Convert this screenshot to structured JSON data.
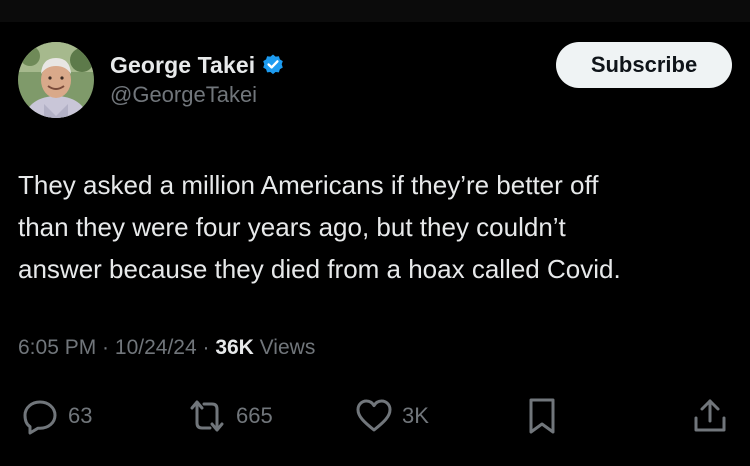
{
  "author": {
    "display_name": "George Takei",
    "handle": "@GeorgeTakei",
    "verified_icon": "verified-badge-icon",
    "verified_color": "#1d9bf0"
  },
  "header": {
    "subscribe_label": "Subscribe"
  },
  "tweet": {
    "line1": "They asked a million Americans if they’re better off",
    "line2": "than they were four years ago, but they couldn’t",
    "line3": "answer because they died from a hoax called Covid."
  },
  "meta": {
    "time": "6:05 PM",
    "sep1": " · ",
    "date": "10/24/24",
    "sep2": " · ",
    "views_count": "36K",
    "views_label": " Views"
  },
  "actions": {
    "replies": "63",
    "reposts": "665",
    "likes": "3K",
    "icons": [
      "reply-icon",
      "repost-icon",
      "like-icon",
      "bookmark-icon",
      "share-icon"
    ]
  },
  "colors": {
    "background": "#000000",
    "text": "#e7e9ea",
    "secondary": "#71767b",
    "button_bg": "#eff3f4",
    "button_text": "#0f1419"
  }
}
